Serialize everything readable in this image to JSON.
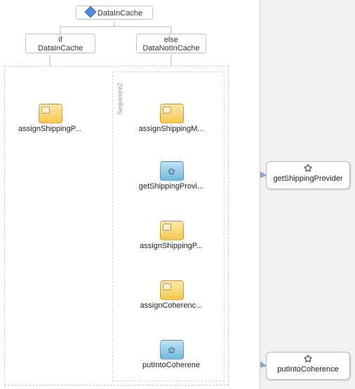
{
  "decision": {
    "label": "DataInCache"
  },
  "branches": {
    "if": {
      "top": "if",
      "bot": "DataInCache"
    },
    "else": {
      "top": "else",
      "bot": "DataNotInCache"
    }
  },
  "sequence_label": "Sequence2",
  "left": {
    "assign1": {
      "label": "assignShippingP..."
    }
  },
  "right": {
    "assign1": {
      "label": "assignShippingM..."
    },
    "invoke1": {
      "label": "getShippingProvi..."
    },
    "assign2": {
      "label": "assignShippingP..."
    },
    "assign3": {
      "label": "assignCoherenc..."
    },
    "invoke2": {
      "label": "putIntoCoherene"
    }
  },
  "externals": {
    "getShippingProvider": {
      "label": "getShippingProvider"
    },
    "putIntoCoherence": {
      "label": "putIntoCoherence"
    }
  }
}
